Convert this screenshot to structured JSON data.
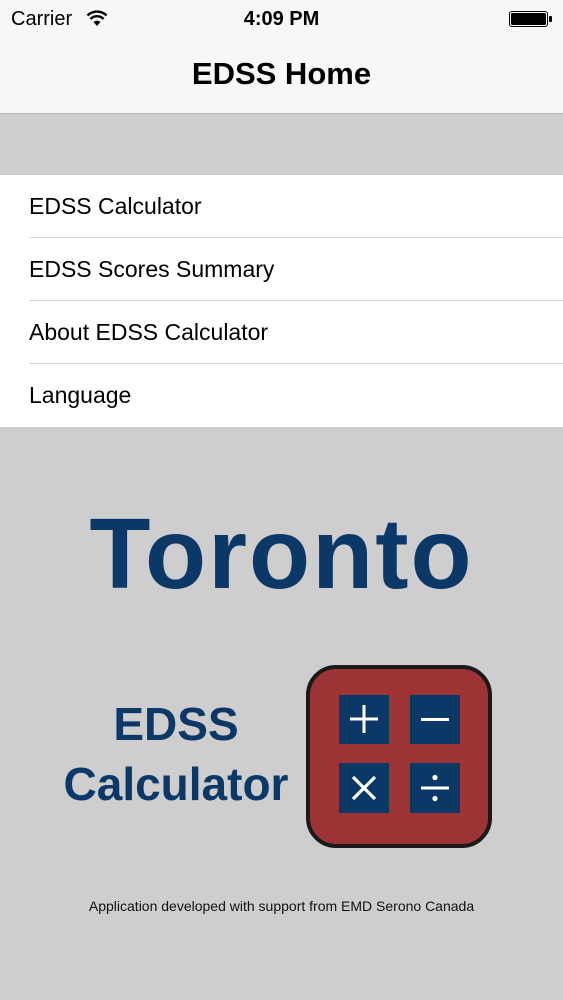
{
  "status_bar": {
    "carrier": "Carrier",
    "time": "4:09 PM"
  },
  "nav": {
    "title": "EDSS Home"
  },
  "menu": {
    "items": [
      {
        "label": "EDSS Calculator"
      },
      {
        "label": "EDSS Scores Summary"
      },
      {
        "label": "About EDSS Calculator"
      },
      {
        "label": "Language"
      }
    ]
  },
  "logo": {
    "title": "Toronto",
    "subtitle_line1": "EDSS",
    "subtitle_line2": "Calculator",
    "icon": "calculator-icon"
  },
  "footer": {
    "text": "Application developed with support from EMD Serono Canada"
  },
  "colors": {
    "brand_blue": "#0c3868",
    "calc_red": "#9c3335",
    "background_gray": "#cececf"
  }
}
